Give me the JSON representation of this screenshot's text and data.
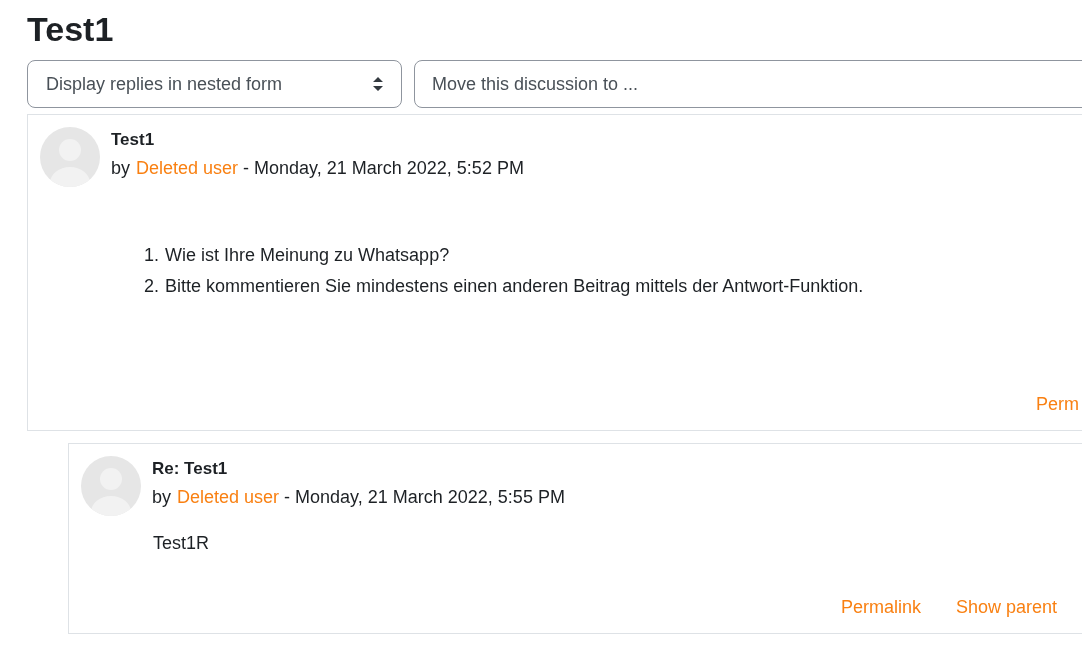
{
  "page_title": "Test1",
  "controls": {
    "display_mode": {
      "value": "Display replies in nested form"
    },
    "move_discussion": {
      "placeholder": "Move this discussion to ..."
    }
  },
  "posts": [
    {
      "subject": "Test1",
      "by": "by",
      "author": "Deleted user",
      "date": " - Monday, 21 March 2022, 5:52 PM",
      "body": [
        {
          "number": "1.",
          "text": "Wie ist Ihre Meinung zu Whatsapp?"
        },
        {
          "number": "2.",
          "text": "Bitte kommentieren Sie mindestens einen anderen Beitrag mittels der Antwort-Funktion."
        }
      ],
      "links": [
        "Perm"
      ],
      "children": [
        {
          "subject": "Re: Test1",
          "by": "by",
          "author": "Deleted user",
          "date": " - Monday, 21 March 2022, 5:55 PM",
          "body": [
            {
              "text": "Test1R"
            }
          ],
          "links": [
            "Permalink",
            "Show parent"
          ]
        }
      ]
    }
  ]
}
